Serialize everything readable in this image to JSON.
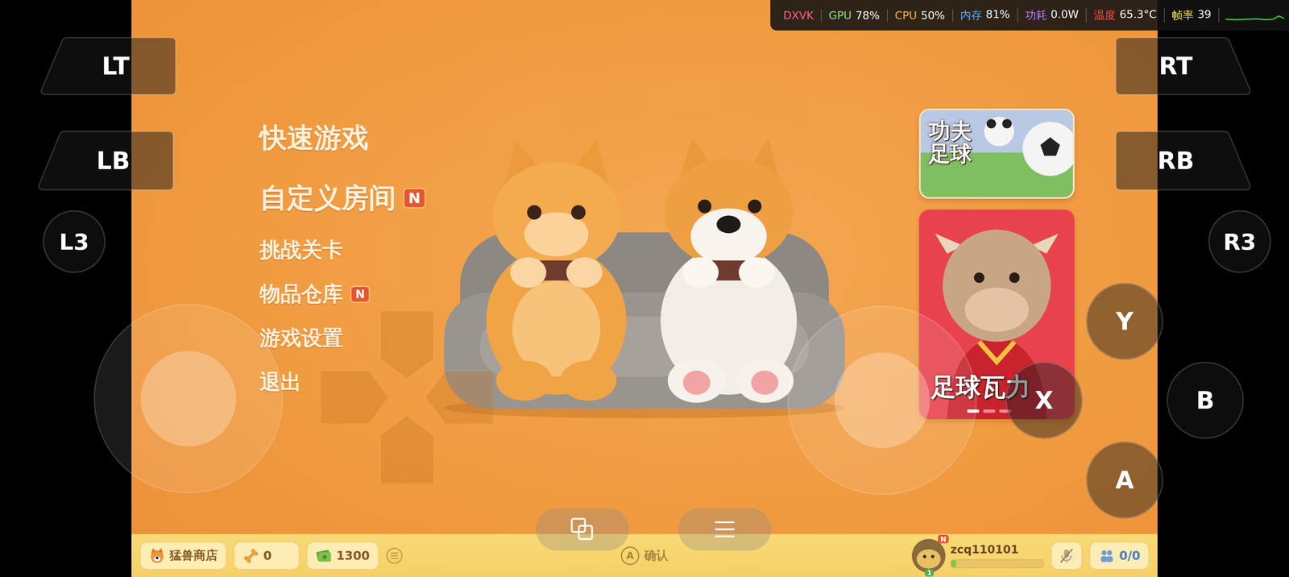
{
  "hud": [
    {
      "label": "DXVK",
      "color": "#ff5d8f"
    },
    {
      "label": "GPU",
      "value": "78%",
      "color": "#86e07a"
    },
    {
      "label": "CPU",
      "value": "50%",
      "color": "#f5b02a"
    },
    {
      "label": "内存",
      "value": "81%",
      "color": "#4fa9ff"
    },
    {
      "label": "功耗",
      "value": "0.0W",
      "color": "#b97cff"
    },
    {
      "label": "温度",
      "value": "65.3°C",
      "color": "#ff4a4a"
    },
    {
      "label": "帧率",
      "value": "39",
      "color": "#f2e24b"
    }
  ],
  "menu": [
    {
      "label": "快速游戏",
      "kind": "primary"
    },
    {
      "label": "自定义房间",
      "kind": "primary",
      "badge": "N"
    },
    {
      "label": "挑战关卡",
      "kind": "secondary"
    },
    {
      "label": "物品仓库",
      "kind": "secondary",
      "badge": "N"
    },
    {
      "label": "游戏设置",
      "kind": "secondary"
    },
    {
      "label": "退出",
      "kind": "secondary"
    }
  ],
  "banners": [
    {
      "title": "功夫足球",
      "kind": "field"
    },
    {
      "title": "足球瓦力",
      "kind": "mascot",
      "pager": [
        {
          "selected": true
        },
        {
          "selected": false
        },
        {
          "selected": false
        }
      ]
    }
  ],
  "bottom_bar": {
    "shop": "猛兽商店",
    "currencies": [
      {
        "kind": "bone",
        "value": "0"
      },
      {
        "kind": "cash",
        "value": "1300"
      }
    ],
    "hint": {
      "key": "A",
      "label": "确认"
    },
    "player": {
      "name": "zcq110101",
      "level": "1",
      "badge": "N",
      "xp": 0.05
    },
    "mic": {
      "muted": true
    },
    "team": "0/0"
  },
  "controls": {
    "left_trigger": "LT",
    "left_bumper": "LB",
    "left_stick_click": "L3",
    "right_trigger": "RT",
    "right_bumper": "RB",
    "right_stick_click": "R3",
    "y": "Y",
    "b": "B",
    "x": "X",
    "a": "A"
  }
}
